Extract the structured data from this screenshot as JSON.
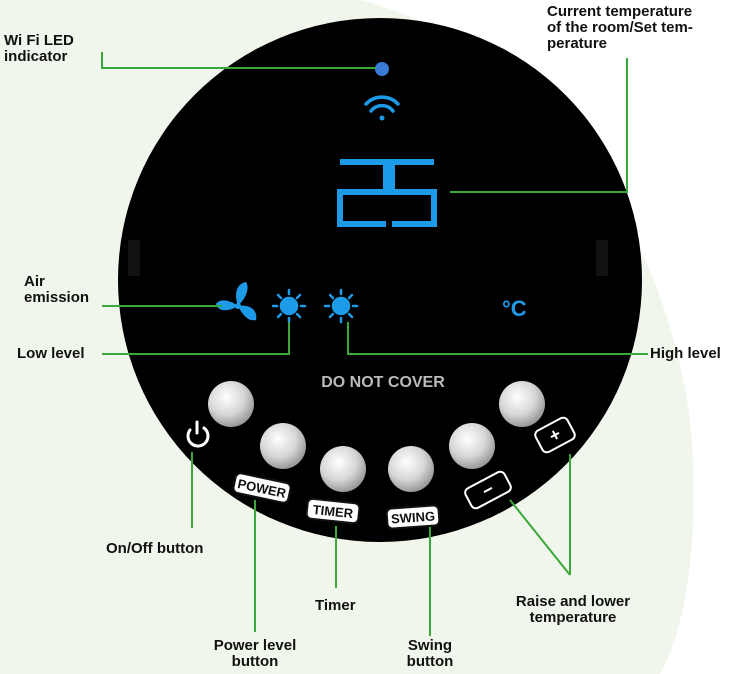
{
  "panel": {
    "display_value": "25",
    "unit": "°C",
    "warning_text": "DO NOT COVER",
    "buttons": {
      "power_label": "POWER",
      "timer_label": "TIMER",
      "swing_label": "SWING",
      "minus_label": "−",
      "plus_label": "+"
    },
    "icons": [
      "wifi-icon",
      "fan-icon",
      "sun-icon",
      "sun-icon",
      "power-icon"
    ]
  },
  "callouts": {
    "wifi_led": "Wi Fi LED\nindicator",
    "current_temp": "Current temperature\nof the room/Set tem-\nperature",
    "air_emission": "Air\nemission",
    "low_level": "Low level",
    "high_level": "High level",
    "on_off": "On/Off  button",
    "timer": "Timer",
    "raise_lower": "Raise and lower\ntemperature",
    "power_level": "Power level\nbutton",
    "swing": "Swing\nbutton"
  },
  "colors": {
    "panel": "#000000",
    "display_blue": "#1e9be8",
    "led_blue": "#3a7bd5",
    "leader_green": "#3aa83a",
    "background_green": "#f1f6ec"
  }
}
